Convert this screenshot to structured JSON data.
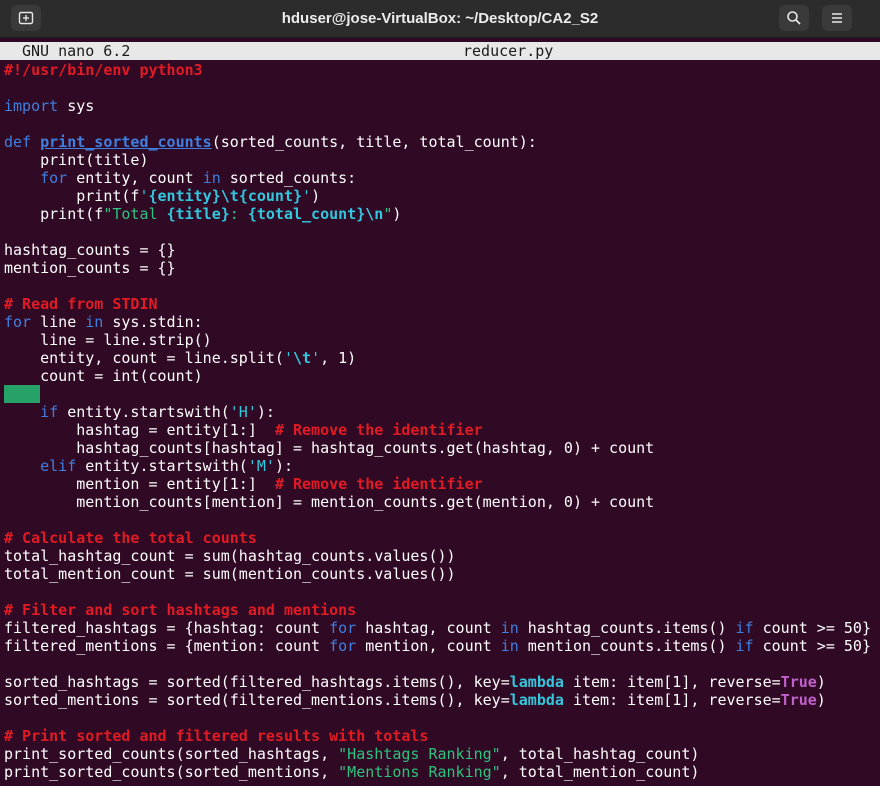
{
  "window": {
    "title": "hduser@jose-VirtualBox: ~/Desktop/CA2_S2",
    "icons": [
      "new-tab-icon",
      "search-icon",
      "hamburger-menu-icon"
    ]
  },
  "nano": {
    "version": "GNU nano 6.2",
    "filename": "reducer.py"
  },
  "colors": {
    "background": "#300a24",
    "keyword": "#3f7fe0",
    "comment": "#e01b24",
    "string": "#33c7de",
    "boolean": "#c061cb",
    "cursor": "#26a269"
  },
  "code": [
    [
      [
        "cm",
        "#!/usr/bin/env python3"
      ]
    ],
    [],
    [
      [
        "kw",
        "import"
      ],
      [
        "pl",
        " sys"
      ]
    ],
    [],
    [
      [
        "kw",
        "def"
      ],
      [
        "pl",
        " "
      ],
      [
        "fn",
        "print_sorted_counts"
      ],
      [
        "pl",
        "(sorted_counts, title, total_count):"
      ]
    ],
    [
      [
        "pl",
        "    print(title)"
      ]
    ],
    [
      [
        "pl",
        "    "
      ],
      [
        "kw",
        "for"
      ],
      [
        "pl",
        " entity, count "
      ],
      [
        "kw",
        "in"
      ],
      [
        "pl",
        " sorted_counts:"
      ]
    ],
    [
      [
        "pl",
        "        print(f"
      ],
      [
        "str",
        "'"
      ],
      [
        "sb",
        "{entity}"
      ],
      [
        "esc",
        "\\t"
      ],
      [
        "sb",
        "{count}"
      ],
      [
        "str",
        "'"
      ],
      [
        "pl",
        ")"
      ]
    ],
    [
      [
        "pl",
        "    print(f"
      ],
      [
        "grn",
        "\"Total "
      ],
      [
        "sb",
        "{title}"
      ],
      [
        "grn",
        ": "
      ],
      [
        "sb",
        "{total_count}"
      ],
      [
        "esc",
        "\\n"
      ],
      [
        "grn",
        "\""
      ],
      [
        "pl",
        ")"
      ]
    ],
    [],
    [
      [
        "pl",
        "hashtag_counts = {}"
      ]
    ],
    [
      [
        "pl",
        "mention_counts = {}"
      ]
    ],
    [],
    [
      [
        "cm",
        "# Read from STDIN"
      ]
    ],
    [
      [
        "kw",
        "for"
      ],
      [
        "pl",
        " line "
      ],
      [
        "kw",
        "in"
      ],
      [
        "pl",
        " sys.stdin:"
      ]
    ],
    [
      [
        "pl",
        "    line = line.strip()"
      ]
    ],
    [
      [
        "pl",
        "    entity, count = line.split("
      ],
      [
        "str",
        "'"
      ],
      [
        "esc",
        "\\t"
      ],
      [
        "str",
        "'"
      ],
      [
        "pl",
        ", 1)"
      ]
    ],
    [
      [
        "pl",
        "    count = int(count)"
      ]
    ],
    [
      [
        "cursor",
        ""
      ]
    ],
    [
      [
        "pl",
        "    "
      ],
      [
        "kw",
        "if"
      ],
      [
        "pl",
        " entity.startswith("
      ],
      [
        "str",
        "'H'"
      ],
      [
        "pl",
        "):"
      ]
    ],
    [
      [
        "pl",
        "        hashtag = entity[1:]  "
      ],
      [
        "cm",
        "# Remove the identifier"
      ]
    ],
    [
      [
        "pl",
        "        hashtag_counts[hashtag] = hashtag_counts.get(hashtag, 0) + count"
      ]
    ],
    [
      [
        "pl",
        "    "
      ],
      [
        "kw",
        "elif"
      ],
      [
        "pl",
        " entity.startswith("
      ],
      [
        "str",
        "'M'"
      ],
      [
        "pl",
        "):"
      ]
    ],
    [
      [
        "pl",
        "        mention = entity[1:]  "
      ],
      [
        "cm",
        "# Remove the identifier"
      ]
    ],
    [
      [
        "pl",
        "        mention_counts[mention] = mention_counts.get(mention, 0) + count"
      ]
    ],
    [],
    [
      [
        "cm",
        "# Calculate the total counts"
      ]
    ],
    [
      [
        "pl",
        "total_hashtag_count = sum(hashtag_counts.values())"
      ]
    ],
    [
      [
        "pl",
        "total_mention_count = sum(mention_counts.values())"
      ]
    ],
    [],
    [
      [
        "cm",
        "# Filter and sort hashtags and mentions"
      ]
    ],
    [
      [
        "pl",
        "filtered_hashtags = {hashtag: count "
      ],
      [
        "kw",
        "for"
      ],
      [
        "pl",
        " hashtag, count "
      ],
      [
        "kw",
        "in"
      ],
      [
        "pl",
        " hashtag_counts.items() "
      ],
      [
        "kw",
        "if"
      ],
      [
        "pl",
        " count >= 50}"
      ]
    ],
    [
      [
        "pl",
        "filtered_mentions = {mention: count "
      ],
      [
        "kw",
        "for"
      ],
      [
        "pl",
        " mention, count "
      ],
      [
        "kw",
        "in"
      ],
      [
        "pl",
        " mention_counts.items() "
      ],
      [
        "kw",
        "if"
      ],
      [
        "pl",
        " count >= 50}"
      ]
    ],
    [],
    [
      [
        "pl",
        "sorted_hashtags = sorted(filtered_hashtags.items(), key="
      ],
      [
        "kw2",
        "lambda"
      ],
      [
        "pl",
        " item: item[1], reverse="
      ],
      [
        "bool",
        "True"
      ],
      [
        "pl",
        ")"
      ]
    ],
    [
      [
        "pl",
        "sorted_mentions = sorted(filtered_mentions.items(), key="
      ],
      [
        "kw2",
        "lambda"
      ],
      [
        "pl",
        " item: item[1], reverse="
      ],
      [
        "bool",
        "True"
      ],
      [
        "pl",
        ")"
      ]
    ],
    [],
    [
      [
        "cm",
        "# Print sorted and filtered results with totals"
      ]
    ],
    [
      [
        "pl",
        "print_sorted_counts(sorted_hashtags, "
      ],
      [
        "grn",
        "\"Hashtags Ranking\""
      ],
      [
        "pl",
        ", total_hashtag_count)"
      ]
    ],
    [
      [
        "pl",
        "print_sorted_counts(sorted_mentions, "
      ],
      [
        "grn",
        "\"Mentions Ranking\""
      ],
      [
        "pl",
        ", total_mention_count)"
      ]
    ]
  ]
}
